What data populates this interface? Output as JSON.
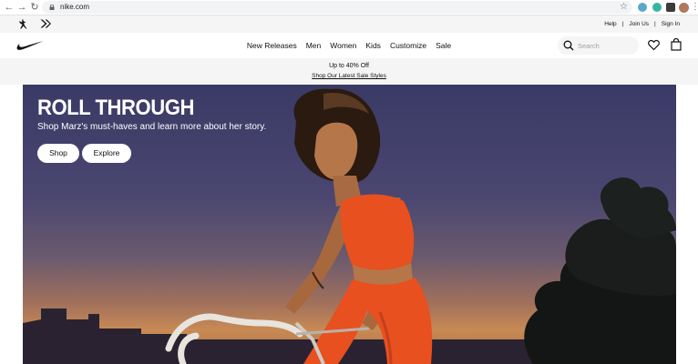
{
  "browser": {
    "url": "nike.com",
    "back_icon": "arrow-left-icon",
    "forward_icon": "arrow-right-icon",
    "reload_icon": "reload-icon"
  },
  "brand_strip": {
    "icons": [
      "jordan-jumpman-icon",
      "converse-icon"
    ],
    "links": [
      "Help",
      "Join Us",
      "Sign In"
    ]
  },
  "nav": {
    "logo": "nike-swoosh-icon",
    "items": [
      "New Releases",
      "Men",
      "Women",
      "Kids",
      "Customize",
      "Sale"
    ],
    "search_placeholder": "Search"
  },
  "promo": {
    "title": "Up to 40% Off",
    "link": "Shop Our Latest Sale Styles"
  },
  "hero": {
    "title": "ROLL THROUGH",
    "subtitle": "Shop Marz's must-haves and learn more about her story.",
    "buttons": [
      "Shop",
      "Explore"
    ]
  },
  "colors": {
    "text": "#111111",
    "strip_bg": "#f5f5f5",
    "outfit": "#e8501f",
    "sky_top": "#3a3a66",
    "sunset": "#c98a54"
  }
}
